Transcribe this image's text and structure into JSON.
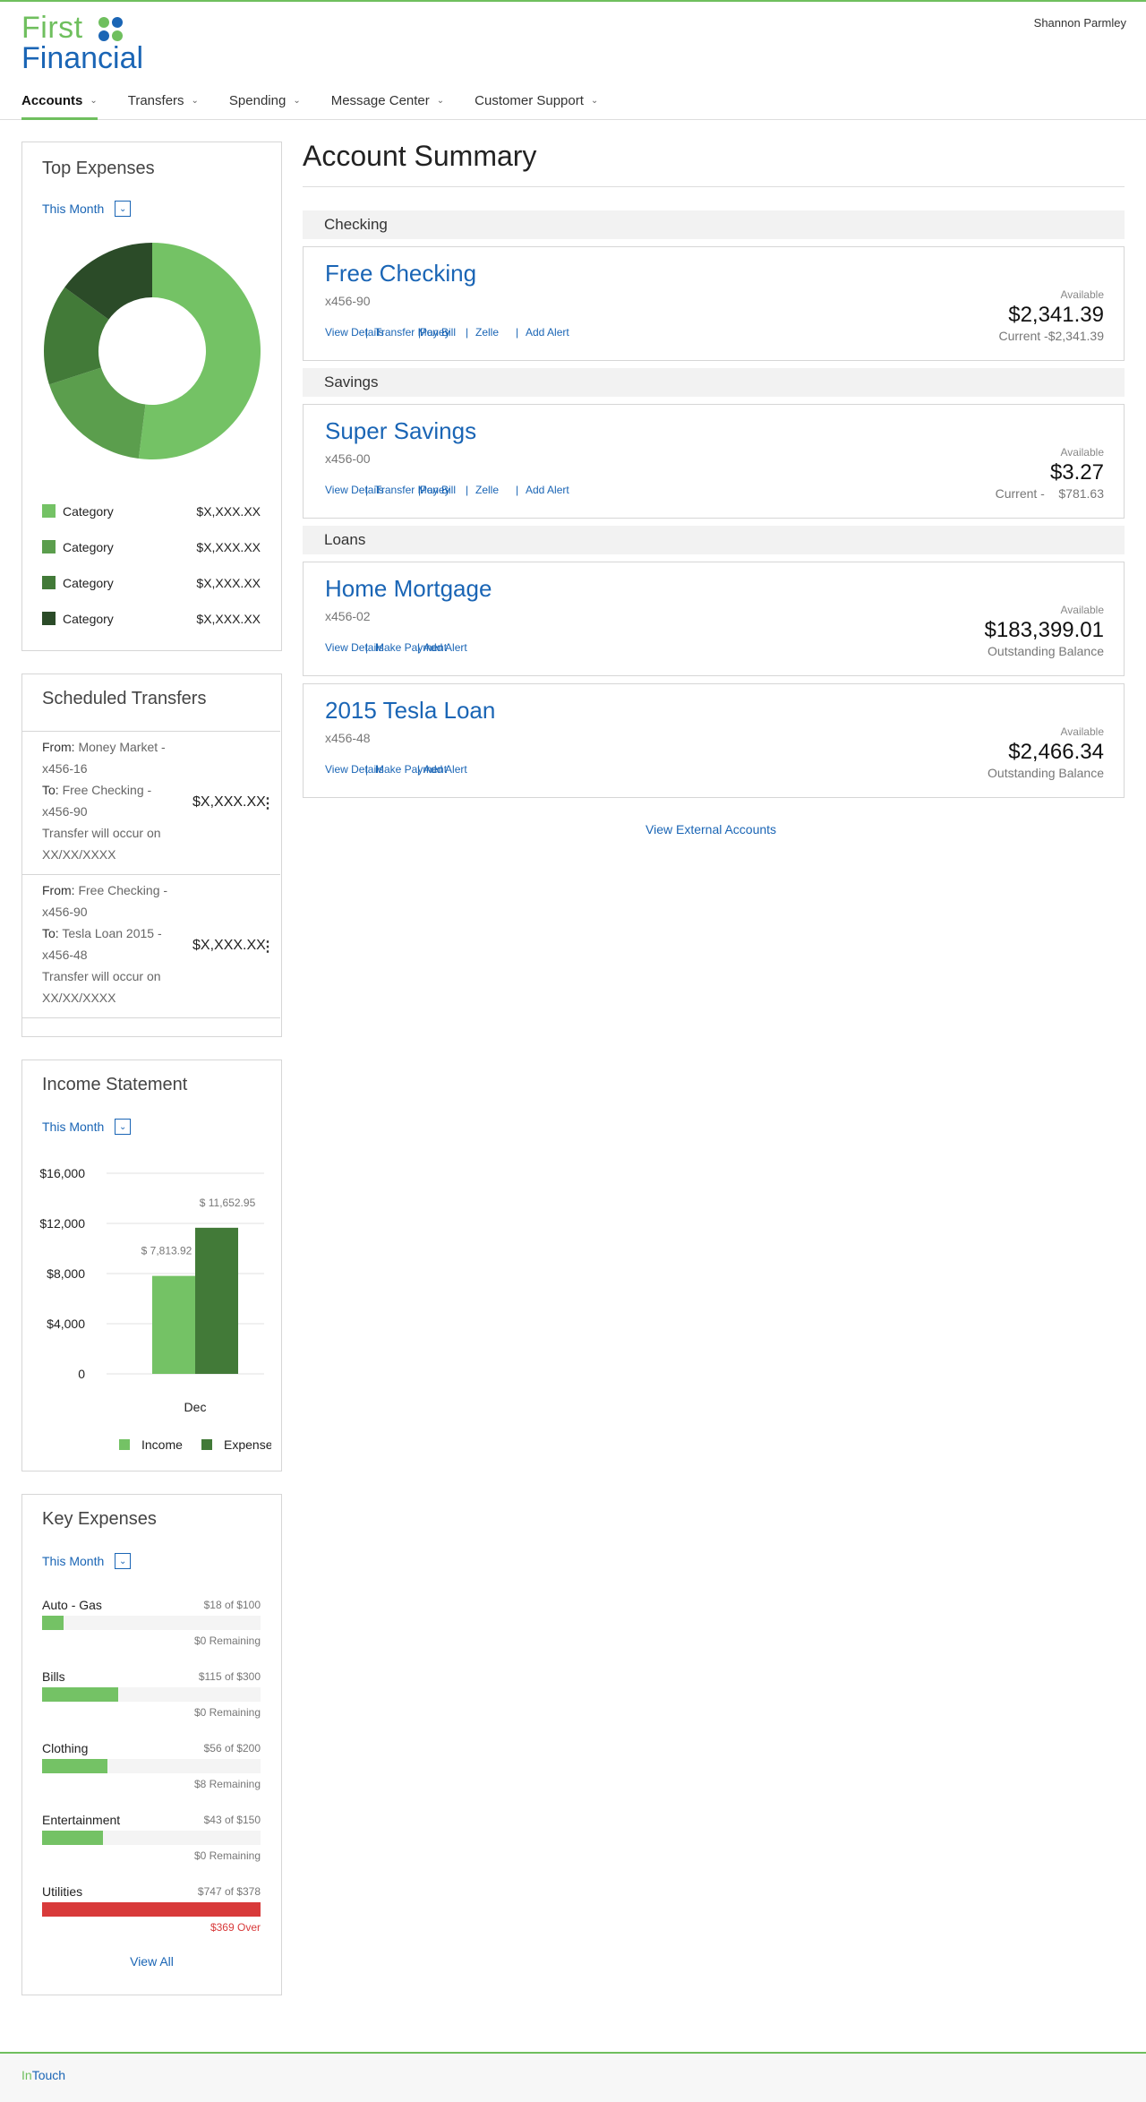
{
  "brand": {
    "line1": "First",
    "line2": "Financial",
    "dot_colors": [
      "#6fbf5e",
      "#1a65b5",
      "#1a65b5",
      "#6fbf5e"
    ]
  },
  "user": {
    "name": "Shannon Parmley"
  },
  "nav": [
    {
      "label": "Accounts",
      "active": true
    },
    {
      "label": "Transfers"
    },
    {
      "label": "Spending"
    },
    {
      "label": "Message Center"
    },
    {
      "label": "Customer Support"
    }
  ],
  "top_expenses": {
    "title": "Top Expenses",
    "period": "This Month",
    "chart_data": {
      "type": "pie",
      "donut": true,
      "values": [
        52,
        18,
        15,
        15
      ],
      "colors": [
        "#74c265",
        "#5b9e4d",
        "#427a38",
        "#2b4b28"
      ]
    },
    "legend": [
      {
        "label": "Category",
        "amount": "$X,XXX.XX",
        "color": "#74c265"
      },
      {
        "label": "Category",
        "amount": "$X,XXX.XX",
        "color": "#5b9e4d"
      },
      {
        "label": "Category",
        "amount": "$X,XXX.XX",
        "color": "#427a38"
      },
      {
        "label": "Category",
        "amount": "$X,XXX.XX",
        "color": "#2b4b28"
      }
    ]
  },
  "scheduled_transfers": {
    "title": "Scheduled Transfers",
    "items": [
      {
        "from_label": "From:",
        "from": " Money Market - x456-16",
        "to_label": "To:",
        "to": " Free Checking - x456-90",
        "note": "Transfer will occur on XX/XX/XXXX",
        "amount": "$X,XXX.XX"
      },
      {
        "from_label": "From:",
        "from": " Free Checking -x456-90",
        "to_label": "To:",
        "to": " Tesla Loan 2015 - x456-48",
        "note": "Transfer will occur on XX/XX/XXXX",
        "amount": "$X,XXX.XX"
      }
    ]
  },
  "income_statement": {
    "title": "Income Statement",
    "period": "This Month",
    "chart_data": {
      "type": "bar",
      "categories": [
        "Dec"
      ],
      "series": [
        {
          "name": "Income",
          "values": [
            7813.92
          ],
          "label": "$ 7,813.92",
          "color": "#74c265"
        },
        {
          "name": "Expenses",
          "values": [
            11652.95
          ],
          "label": "$ 11,652.95",
          "color": "#427a38"
        }
      ],
      "ylim": [
        0,
        16000
      ],
      "yticks": [
        16000,
        12000,
        8000,
        4000,
        0
      ],
      "ytick_labels": [
        "$16,000",
        "$12,000",
        "$8,000",
        "$4,000",
        "0"
      ],
      "grid": true,
      "legend": "bottom"
    }
  },
  "key_expenses": {
    "title": "Key Expenses",
    "period": "This Month",
    "items": [
      {
        "name": "Auto - Gas",
        "of": "$18 of $100",
        "remaining": "$0 Remaining",
        "fraction": 0.1,
        "color": "#74c265",
        "over": false
      },
      {
        "name": "Bills",
        "of": "$115 of $300",
        "remaining": "$0 Remaining",
        "fraction": 0.35,
        "color": "#74c265",
        "over": false
      },
      {
        "name": "Clothing",
        "of": "$56 of $200",
        "remaining": "$8 Remaining",
        "fraction": 0.3,
        "color": "#74c265",
        "over": false
      },
      {
        "name": "Entertainment",
        "of": "$43 of $150",
        "remaining": "$0 Remaining",
        "fraction": 0.28,
        "color": "#74c265",
        "over": false
      },
      {
        "name": "Utilities",
        "of": "$747 of $378",
        "remaining": "$369 Over",
        "fraction": 1.0,
        "color": "#d83a3a",
        "over": true
      }
    ],
    "view_all": "View All"
  },
  "summary": {
    "title": "Account Summary",
    "sections": {
      "checking": "Checking",
      "savings": "Savings",
      "loans": "Loans"
    },
    "accounts": [
      {
        "name": "Free Checking",
        "number": "x456-90",
        "available_label": "Available",
        "balance": "$2,341.39",
        "sub": "Current -$2,341.39",
        "links": [
          "View Details",
          "Transfer Money",
          "Pay Bill",
          "Zelle",
          "Add Alert"
        ]
      },
      {
        "name": "Super Savings",
        "number": "x456-00",
        "available_label": "Available",
        "balance": "$3.27",
        "sub": "Current -    $781.63",
        "links": [
          "View Details",
          "Transfer Money",
          "Pay Bill",
          "Zelle",
          "Add Alert"
        ]
      },
      {
        "name": "Home Mortgage",
        "number": "x456-02",
        "available_label": "Available",
        "balance": "$183,399.01",
        "sub": "Outstanding Balance",
        "links": [
          "View Details",
          "Make Payment",
          "Add Alert"
        ]
      },
      {
        "name": "2015 Tesla Loan",
        "number": "x456-48",
        "available_label": "Available",
        "balance": "$2,466.34",
        "sub": "Outstanding Balance",
        "links": [
          "View Details",
          "Make Payment",
          "Add Alert"
        ]
      }
    ],
    "external_link": "View External Accounts"
  },
  "footer": {
    "logo_in": "In",
    "logo_rest": "Touch"
  }
}
